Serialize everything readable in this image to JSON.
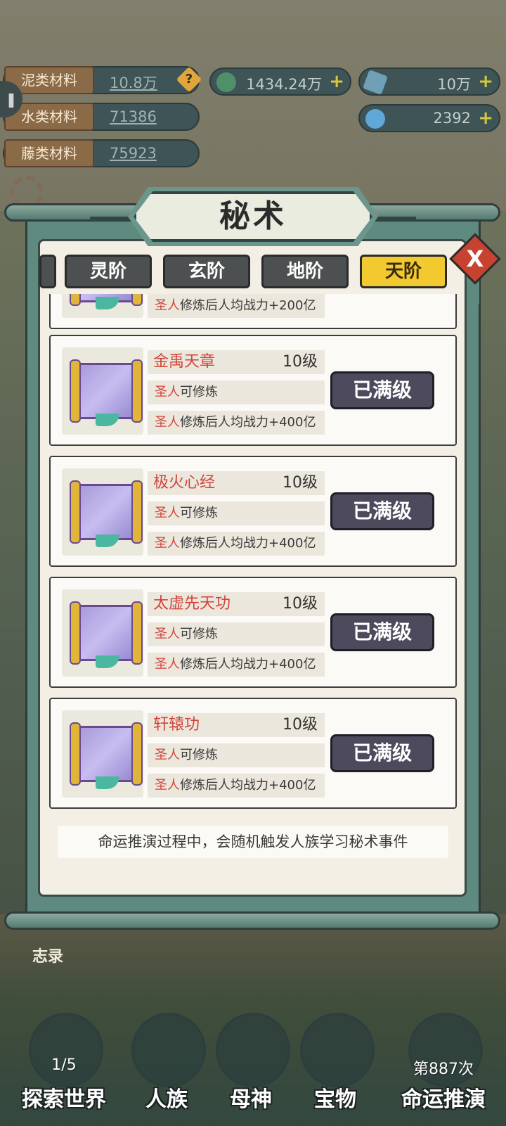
{
  "resources": {
    "materials": [
      {
        "label": "泥类材料",
        "value": "10.8万"
      },
      {
        "label": "水类材料",
        "value": "71386"
      },
      {
        "label": "藤类材料",
        "value": "75923"
      }
    ],
    "currencies": [
      {
        "value": "1434.24万",
        "icon": "jade-coin-icon",
        "color": "#4f8f6a"
      },
      {
        "value": "10万",
        "icon": "crystal-icon",
        "color": "#6fa0b6"
      },
      {
        "value": "2392",
        "icon": "spirit-flame-icon",
        "color": "#5fa8d8"
      }
    ],
    "plus": "+",
    "help_mark": "?"
  },
  "dialog": {
    "title": "秘术",
    "close_glyph": "X",
    "tabs": [
      "灵阶",
      "玄阶",
      "地阶",
      "天阶"
    ],
    "active_tab": "天阶",
    "partial_item": {
      "stat": "修炼后人均战力+200亿",
      "prefix": "圣人"
    },
    "items": [
      {
        "name": "金禹天章",
        "level": "10级",
        "req_prefix": "圣人",
        "req": "可修炼",
        "stat_prefix": "圣人",
        "stat": "修炼后人均战力+400亿",
        "button": "已满级"
      },
      {
        "name": "极火心经",
        "level": "10级",
        "req_prefix": "圣人",
        "req": "可修炼",
        "stat_prefix": "圣人",
        "stat": "修炼后人均战力+400亿",
        "button": "已满级"
      },
      {
        "name": "太虚先天功",
        "level": "10级",
        "req_prefix": "圣人",
        "req": "可修炼",
        "stat_prefix": "圣人",
        "stat": "修炼后人均战力+400亿",
        "button": "已满级"
      },
      {
        "name": "轩辕功",
        "level": "10级",
        "req_prefix": "圣人",
        "req": "可修炼",
        "stat_prefix": "圣人",
        "stat": "修炼后人均战力+400亿",
        "button": "已满级"
      }
    ],
    "tip": "命运推演过程中，会随机触发人族学习秘术事件"
  },
  "bottom": {
    "zhilu": "志录",
    "nav": [
      {
        "label": "探索世界",
        "sub": "1/5"
      },
      {
        "label": "人族",
        "sub": ""
      },
      {
        "label": "母神",
        "sub": ""
      },
      {
        "label": "宝物",
        "sub": ""
      },
      {
        "label": "命运推演",
        "sub": "第887次"
      }
    ]
  }
}
